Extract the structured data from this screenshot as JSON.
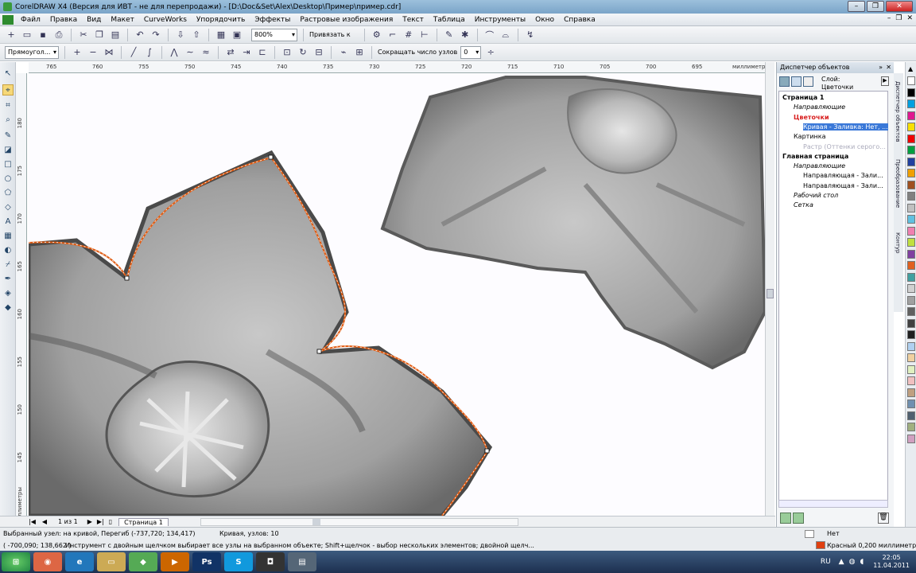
{
  "window": {
    "title": "CorelDRAW X4 (Версия для ИВТ - не для перепродажи) - [D:\\Doc&Set\\Alex\\Desktop\\Пример\\пример.cdr]"
  },
  "menu": [
    "Файл",
    "Правка",
    "Вид",
    "Макет",
    "CurveWorks",
    "Упорядочить",
    "Эффекты",
    "Растровые изображения",
    "Текст",
    "Таблица",
    "Инструменты",
    "Окно",
    "Справка"
  ],
  "toolbar1": {
    "zoom": "800%",
    "snap": "Привязать к"
  },
  "toolbar2": {
    "shape": "Прямоугол...",
    "reduce_label": "Сокращать число узлов",
    "reduce_value": "0"
  },
  "ruler": {
    "h_ticks": [
      "765",
      "760",
      "755",
      "750",
      "745",
      "740",
      "735",
      "730",
      "725",
      "720",
      "715",
      "710",
      "705",
      "700",
      "695"
    ],
    "h_unit": "миллиметры",
    "v_ticks": [
      "180",
      "175",
      "170",
      "165",
      "160",
      "155",
      "150",
      "145"
    ],
    "v_unit": "миллиметры"
  },
  "pages": {
    "count": "1 из 1",
    "tab": "Страница 1"
  },
  "docker": {
    "title": "Диспетчер объектов",
    "layer_label": "Слой:",
    "layer_name": "Цветочки",
    "tree": [
      {
        "label": "Страница 1",
        "bold": true
      },
      {
        "label": "Направляющие",
        "italic": true
      },
      {
        "label": "Цветочки",
        "color": "#d82020",
        "bold": true
      },
      {
        "label": "Кривая - Заливка: Нет, ...",
        "selected": true
      },
      {
        "label": "Картинка"
      },
      {
        "label": "Растр (Оттенки серого...",
        "dim": true
      },
      {
        "label": "Главная страница",
        "bold": true
      },
      {
        "label": "Направляющие",
        "italic": true
      },
      {
        "label": "Направляющая - Зали..."
      },
      {
        "label": "Направляющая - Зали..."
      },
      {
        "label": "Рабочий стол",
        "italic": true
      },
      {
        "label": "Сетка",
        "italic": true
      }
    ]
  },
  "side_tabs": [
    "Диспетчер объектов",
    "Преобразование",
    "Контур"
  ],
  "palette": [
    "#ffffff",
    "#000000",
    "#00a0e0",
    "#e01890",
    "#f8e000",
    "#f00000",
    "#00a040",
    "#2040a0",
    "#f0a000",
    "#a05020",
    "#808080",
    "#c0c0c0",
    "#60c0e0",
    "#f080b0",
    "#c0e040",
    "#8040a0",
    "#e06020",
    "#40a0a0",
    "#d0d0d0",
    "#a0a0a0",
    "#606060",
    "#404040",
    "#202020",
    "#b0d0f0",
    "#f0d0a0",
    "#e0f0c0",
    "#f0c0c0",
    "#c0a080",
    "#7090b0",
    "#506070",
    "#a0b080",
    "#d0a0c0"
  ],
  "status": {
    "node_info": "Выбранный узел: на кривой, Перегиб (-737,720; 134,417)",
    "curve_info": "Кривая, узлов: 10",
    "coords": "( -700,090; 138,662 )",
    "hint": "Инструмент с двойным щелчком выбирает все узлы на выбранном объекте; Shift+щелчок - выбор нескольких элементов; двойной щелч...",
    "fill": "Нет",
    "outline": "Красный  0,200 миллиметры",
    "outline_color": "#e04010"
  },
  "taskbar": {
    "lang": "RU",
    "time": "22:05",
    "date": "11.04.2011"
  },
  "colors": {
    "curve": "#e05a10",
    "ruler": "#f4f6f8"
  }
}
